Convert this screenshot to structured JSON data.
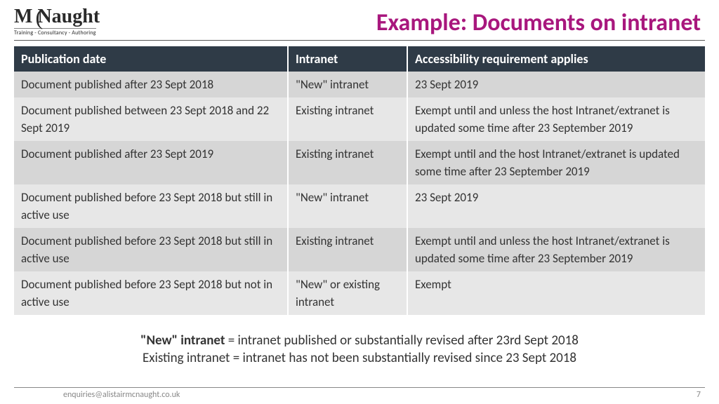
{
  "logo": {
    "name": "M Naught",
    "tagline": "Training - Consultancy - Authoring"
  },
  "title": "Example: Documents on intranet",
  "table": {
    "headers": {
      "pub": "Publication date",
      "intranet": "Intranet",
      "accreq": "Accessibility requirement applies"
    },
    "rows": [
      {
        "pub": "Document published after 23 Sept 2018",
        "intranet": "\"New\" intranet",
        "accreq": "23 Sept 2019"
      },
      {
        "pub": "Document published between 23 Sept 2018 and 22 Sept 2019",
        "intranet": "Existing intranet",
        "accreq": "Exempt until and unless the host Intranet/extranet is updated some time after 23 September 2019"
      },
      {
        "pub": "Document published after 23 Sept 2019",
        "intranet": "Existing  intranet",
        "accreq": "Exempt until and the host Intranet/extranet is updated some time after 23 September 2019"
      },
      {
        "pub": "Document published before 23 Sept 2018 but still in active use",
        "intranet": "\"New\" intranet",
        "accreq": "23 Sept 2019"
      },
      {
        "pub": "Document published before 23 Sept 2018 but still in active use",
        "intranet": "Existing intranet",
        "accreq": "Exempt until and unless the host Intranet/extranet is updated some time after 23 September 2019"
      },
      {
        "pub": "Document published before 23 Sept 2018 but not in active use",
        "intranet": "\"New\" or existing intranet",
        "accreq": "Exempt"
      }
    ]
  },
  "notes": {
    "new_label": "\"New\" intranet",
    "new_def": " = intranet published or substantially revised after 23rd Sept 2018",
    "existing": "Existing intranet = intranet has not been substantially revised since 23 Sept 2018"
  },
  "footer": {
    "email": "enquiries@alistairmcnaught.co.uk",
    "page": "7"
  }
}
